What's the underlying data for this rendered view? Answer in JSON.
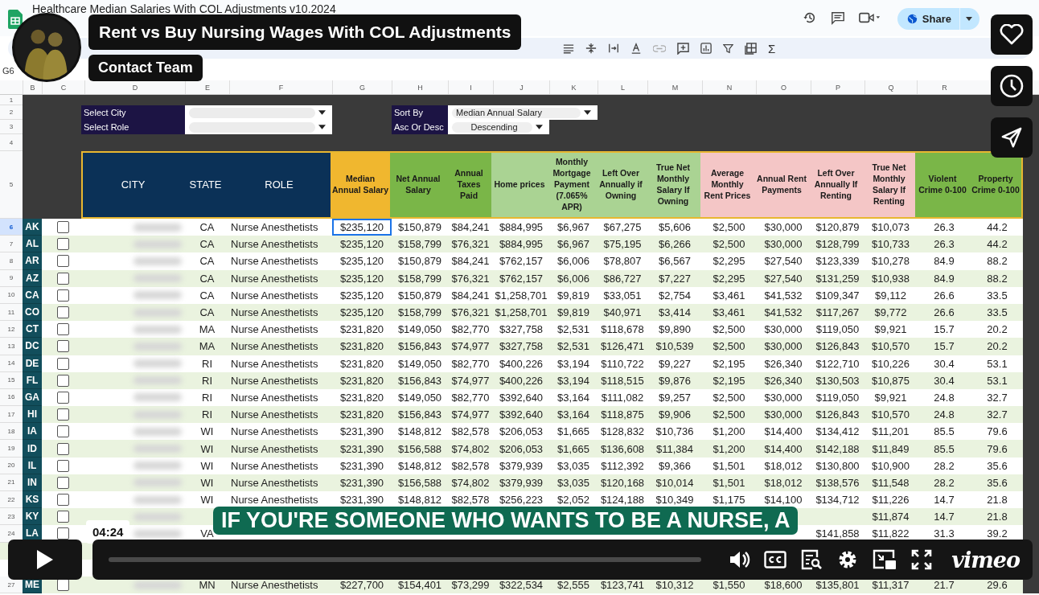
{
  "sheet": {
    "title": "Healthcare Median Salaries With COL Adjustments v10.2024",
    "cell_ref": "G6",
    "share_label": "Share",
    "toolbar_symbol": "Σ",
    "column_letters": [
      "B",
      "C",
      "D",
      "E",
      "F",
      "G",
      "H",
      "I",
      "J",
      "K",
      "L",
      "M",
      "N",
      "O",
      "P",
      "Q",
      "R"
    ],
    "top_row_numbers": [
      "1",
      "2",
      "3",
      "4",
      "5"
    ],
    "filters_left": [
      {
        "label": "Select City"
      },
      {
        "label": "Select Role"
      }
    ],
    "filters_right": [
      {
        "label": "Sort By",
        "value": "Median Annual Salary"
      },
      {
        "label": "Asc Or Desc",
        "value": "Descending"
      }
    ],
    "headers": [
      {
        "label": "CITY",
        "color": "#0b3157",
        "kind": "key"
      },
      {
        "label": "STATE",
        "color": "#0b3157",
        "kind": "key"
      },
      {
        "label": "ROLE",
        "color": "#0b3157",
        "kind": "key"
      },
      {
        "label": "Median Annual Salary",
        "color": "#f0b72f",
        "kind": "metric"
      },
      {
        "label": "Net Annual Salary",
        "color": "#7ab648",
        "kind": "metric"
      },
      {
        "label": "Annual Taxes Paid",
        "color": "#7ab648",
        "kind": "metric"
      },
      {
        "label": "Home prices",
        "color": "#aad393",
        "kind": "metric"
      },
      {
        "label": "Monthly Mortgage Payment (7.065% APR)",
        "color": "#aad393",
        "kind": "metric"
      },
      {
        "label": "Left Over Annually if Owning",
        "color": "#aad393",
        "kind": "metric"
      },
      {
        "label": "True Net Monthly Salary If Owning",
        "color": "#aad393",
        "kind": "metric"
      },
      {
        "label": "Average Monthly Rent Prices",
        "color": "#f4c6c6",
        "kind": "metric"
      },
      {
        "label": "Annual Rent Payments",
        "color": "#f4c6c6",
        "kind": "metric"
      },
      {
        "label": "Left Over Annually If Renting",
        "color": "#f4c6c6",
        "kind": "metric"
      },
      {
        "label": "True Net Monthly Salary If Renting",
        "color": "#f4c6c6",
        "kind": "metric"
      },
      {
        "label": "Violent Crime 0-100",
        "color": "#7ab648",
        "kind": "metric"
      },
      {
        "label": "Property Crime 0-100",
        "color": "#7ab648",
        "kind": "metric"
      }
    ],
    "rows": [
      {
        "kind": "data",
        "row_number": "6",
        "code": "AK",
        "checked": false,
        "selected": true,
        "state": "CA",
        "role": "Nurse Anesthetists",
        "values": {
          "G": "$235,120",
          "H": "$150,879",
          "I": "$84,241",
          "J": "$884,995",
          "K": "$6,967",
          "L": "$67,275",
          "M": "$5,606",
          "N": "$2,500",
          "O": "$30,000",
          "P": "$120,879",
          "Q": "$10,073",
          "R": "26.3",
          "S": "44.2"
        }
      },
      {
        "kind": "data",
        "row_number": "7",
        "code": "AL",
        "checked": false,
        "selected": false,
        "state": "CA",
        "role": "Nurse Anesthetists",
        "values": {
          "G": "$235,120",
          "H": "$158,799",
          "I": "$76,321",
          "J": "$884,995",
          "K": "$6,967",
          "L": "$75,195",
          "M": "$6,266",
          "N": "$2,500",
          "O": "$30,000",
          "P": "$128,799",
          "Q": "$10,733",
          "R": "26.3",
          "S": "44.2"
        }
      },
      {
        "kind": "data",
        "row_number": "8",
        "code": "AR",
        "checked": false,
        "selected": false,
        "state": "CA",
        "role": "Nurse Anesthetists",
        "values": {
          "G": "$235,120",
          "H": "$150,879",
          "I": "$84,241",
          "J": "$762,157",
          "K": "$6,006",
          "L": "$78,807",
          "M": "$6,567",
          "N": "$2,295",
          "O": "$27,540",
          "P": "$123,339",
          "Q": "$10,278",
          "R": "84.9",
          "S": "88.2"
        }
      },
      {
        "kind": "data",
        "row_number": "9",
        "code": "AZ",
        "checked": false,
        "selected": false,
        "state": "CA",
        "role": "Nurse Anesthetists",
        "values": {
          "G": "$235,120",
          "H": "$158,799",
          "I": "$76,321",
          "J": "$762,157",
          "K": "$6,006",
          "L": "$86,727",
          "M": "$7,227",
          "N": "$2,295",
          "O": "$27,540",
          "P": "$131,259",
          "Q": "$10,938",
          "R": "84.9",
          "S": "88.2"
        }
      },
      {
        "kind": "data",
        "row_number": "10",
        "code": "CA",
        "checked": false,
        "selected": false,
        "state": "CA",
        "role": "Nurse Anesthetists",
        "values": {
          "G": "$235,120",
          "H": "$150,879",
          "I": "$84,241",
          "J": "$1,258,701",
          "K": "$9,819",
          "L": "$33,051",
          "M": "$2,754",
          "N": "$3,461",
          "O": "$41,532",
          "P": "$109,347",
          "Q": "$9,112",
          "R": "26.6",
          "S": "33.5"
        }
      },
      {
        "kind": "data",
        "row_number": "11",
        "code": "CO",
        "checked": false,
        "selected": false,
        "state": "CA",
        "role": "Nurse Anesthetists",
        "values": {
          "G": "$235,120",
          "H": "$158,799",
          "I": "$76,321",
          "J": "$1,258,701",
          "K": "$9,819",
          "L": "$40,971",
          "M": "$3,414",
          "N": "$3,461",
          "O": "$41,532",
          "P": "$117,267",
          "Q": "$9,772",
          "R": "26.6",
          "S": "33.5"
        }
      },
      {
        "kind": "data",
        "row_number": "12",
        "code": "CT",
        "checked": false,
        "selected": false,
        "state": "MA",
        "role": "Nurse Anesthetists",
        "values": {
          "G": "$231,820",
          "H": "$149,050",
          "I": "$82,770",
          "J": "$327,758",
          "K": "$2,531",
          "L": "$118,678",
          "M": "$9,890",
          "N": "$2,500",
          "O": "$30,000",
          "P": "$119,050",
          "Q": "$9,921",
          "R": "15.7",
          "S": "20.2"
        }
      },
      {
        "kind": "data",
        "row_number": "13",
        "code": "DC",
        "checked": false,
        "selected": false,
        "state": "MA",
        "role": "Nurse Anesthetists",
        "values": {
          "G": "$231,820",
          "H": "$156,843",
          "I": "$74,977",
          "J": "$327,758",
          "K": "$2,531",
          "L": "$126,471",
          "M": "$10,539",
          "N": "$2,500",
          "O": "$30,000",
          "P": "$126,843",
          "Q": "$10,570",
          "R": "15.7",
          "S": "20.2"
        }
      },
      {
        "kind": "data",
        "row_number": "14",
        "code": "DE",
        "checked": false,
        "selected": false,
        "state": "RI",
        "role": "Nurse Anesthetists",
        "values": {
          "G": "$231,820",
          "H": "$149,050",
          "I": "$82,770",
          "J": "$400,226",
          "K": "$3,194",
          "L": "$110,722",
          "M": "$9,227",
          "N": "$2,195",
          "O": "$26,340",
          "P": "$122,710",
          "Q": "$10,226",
          "R": "30.4",
          "S": "53.1"
        }
      },
      {
        "kind": "data",
        "row_number": "15",
        "code": "FL",
        "checked": false,
        "selected": false,
        "state": "RI",
        "role": "Nurse Anesthetists",
        "values": {
          "G": "$231,820",
          "H": "$156,843",
          "I": "$74,977",
          "J": "$400,226",
          "K": "$3,194",
          "L": "$118,515",
          "M": "$9,876",
          "N": "$2,195",
          "O": "$26,340",
          "P": "$130,503",
          "Q": "$10,875",
          "R": "30.4",
          "S": "53.1"
        }
      },
      {
        "kind": "data",
        "row_number": "16",
        "code": "GA",
        "checked": false,
        "selected": false,
        "state": "RI",
        "role": "Nurse Anesthetists",
        "values": {
          "G": "$231,820",
          "H": "$149,050",
          "I": "$82,770",
          "J": "$392,640",
          "K": "$3,164",
          "L": "$111,082",
          "M": "$9,257",
          "N": "$2,500",
          "O": "$30,000",
          "P": "$119,050",
          "Q": "$9,921",
          "R": "24.8",
          "S": "32.7"
        }
      },
      {
        "kind": "data",
        "row_number": "17",
        "code": "HI",
        "checked": false,
        "selected": false,
        "state": "RI",
        "role": "Nurse Anesthetists",
        "values": {
          "G": "$231,820",
          "H": "$156,843",
          "I": "$74,977",
          "J": "$392,640",
          "K": "$3,164",
          "L": "$118,875",
          "M": "$9,906",
          "N": "$2,500",
          "O": "$30,000",
          "P": "$126,843",
          "Q": "$10,570",
          "R": "24.8",
          "S": "32.7"
        }
      },
      {
        "kind": "data",
        "row_number": "18",
        "code": "IA",
        "checked": false,
        "selected": false,
        "state": "WI",
        "role": "Nurse Anesthetists",
        "values": {
          "G": "$231,390",
          "H": "$148,812",
          "I": "$82,578",
          "J": "$206,053",
          "K": "$1,665",
          "L": "$128,832",
          "M": "$10,736",
          "N": "$1,200",
          "O": "$14,400",
          "P": "$134,412",
          "Q": "$11,201",
          "R": "85.5",
          "S": "79.6"
        }
      },
      {
        "kind": "data",
        "row_number": "19",
        "code": "ID",
        "checked": false,
        "selected": false,
        "state": "WI",
        "role": "Nurse Anesthetists",
        "values": {
          "G": "$231,390",
          "H": "$156,588",
          "I": "$74,802",
          "J": "$206,053",
          "K": "$1,665",
          "L": "$136,608",
          "M": "$11,384",
          "N": "$1,200",
          "O": "$14,400",
          "P": "$142,188",
          "Q": "$11,849",
          "R": "85.5",
          "S": "79.6"
        }
      },
      {
        "kind": "data",
        "row_number": "20",
        "code": "IL",
        "checked": false,
        "selected": false,
        "state": "WI",
        "role": "Nurse Anesthetists",
        "values": {
          "G": "$231,390",
          "H": "$148,812",
          "I": "$82,578",
          "J": "$379,939",
          "K": "$3,035",
          "L": "$112,392",
          "M": "$9,366",
          "N": "$1,501",
          "O": "$18,012",
          "P": "$130,800",
          "Q": "$10,900",
          "R": "28.2",
          "S": "35.6"
        }
      },
      {
        "kind": "data",
        "row_number": "21",
        "code": "IN",
        "checked": false,
        "selected": false,
        "state": "WI",
        "role": "Nurse Anesthetists",
        "values": {
          "G": "$231,390",
          "H": "$156,588",
          "I": "$74,802",
          "J": "$379,939",
          "K": "$3,035",
          "L": "$120,168",
          "M": "$10,014",
          "N": "$1,501",
          "O": "$18,012",
          "P": "$138,576",
          "Q": "$11,548",
          "R": "28.2",
          "S": "35.6"
        }
      },
      {
        "kind": "data",
        "row_number": "22",
        "code": "KS",
        "checked": false,
        "selected": false,
        "state": "WI",
        "role": "Nurse Anesthetists",
        "values": {
          "G": "$231,390",
          "H": "$148,812",
          "I": "$82,578",
          "J": "$256,223",
          "K": "$2,052",
          "L": "$124,188",
          "M": "$10,349",
          "N": "$1,175",
          "O": "$14,100",
          "P": "$134,712",
          "Q": "$11,226",
          "R": "14.7",
          "S": "21.8"
        }
      },
      {
        "kind": "data",
        "row_number": "23",
        "code": "KY",
        "checked": false,
        "selected": false,
        "values": {
          "Q": "$11,874",
          "R": "14.7",
          "S": "21.8"
        }
      },
      {
        "kind": "data",
        "row_number": "24",
        "code": "LA",
        "checked": false,
        "selected": false,
        "state": "VA",
        "values": {
          "P": "$141,858",
          "Q": "$11,822",
          "R": "31.3",
          "S": "39.2"
        }
      },
      {
        "kind": "covered"
      },
      {
        "kind": "covered"
      },
      {
        "kind": "data",
        "row_number": "27",
        "code": "ME",
        "checked": false,
        "selected": false,
        "state": "MN",
        "role": "Nurse Anesthetists",
        "values": {
          "G": "$227,700",
          "H": "$154,401",
          "I": "$73,299",
          "J": "$322,534",
          "K": "$2,555",
          "L": "$123,741",
          "M": "$10,312",
          "N": "$1,550",
          "O": "$18,600",
          "P": "$135,801",
          "Q": "$11,317",
          "R": "21.7",
          "S": "29.6"
        }
      }
    ]
  },
  "video": {
    "title": "Rent vs Buy Nursing Wages With COL Adjustments",
    "contact_label": "Contact Team",
    "caption": "IF YOU'RE SOMEONE WHO WANTS TO BE A NURSE, A",
    "time": "04:24",
    "logo": "vimeo"
  }
}
